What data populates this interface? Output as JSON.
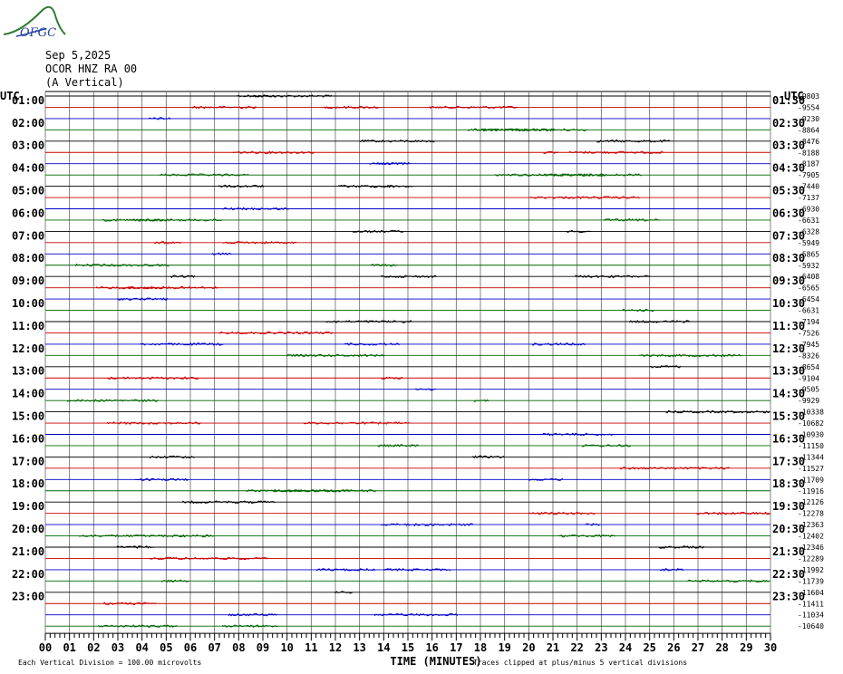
{
  "logo": {
    "text": "OFGC"
  },
  "header": {
    "date": "Sep 5,2025",
    "station": "OCOR HNZ RA 00",
    "component": "(A Vertical)"
  },
  "utc_label": "UTC",
  "chart_data": {
    "type": "helicorder",
    "x": {
      "label": "TIME (MINUTES)",
      "range": [
        0,
        30
      ],
      "tick_labels": [
        "00",
        "01",
        "02",
        "03",
        "04",
        "05",
        "06",
        "07",
        "08",
        "09",
        "10",
        "11",
        "12",
        "13",
        "14",
        "15",
        "16",
        "17",
        "18",
        "19",
        "20",
        "21",
        "22",
        "23",
        "24",
        "25",
        "26",
        "27",
        "28",
        "29",
        "30"
      ]
    },
    "left_labels": [
      "01:00",
      "02:00",
      "03:00",
      "04:00",
      "05:00",
      "06:00",
      "07:00",
      "08:00",
      "09:00",
      "10:00",
      "11:00",
      "12:00",
      "13:00",
      "14:00",
      "15:00",
      "16:00",
      "17:00",
      "18:00",
      "19:00",
      "20:00",
      "21:00",
      "22:00",
      "23:00"
    ],
    "right_labels": [
      "01:30",
      "02:30",
      "03:30",
      "04:30",
      "05:30",
      "06:30",
      "07:30",
      "08:30",
      "09:30",
      "10:30",
      "11:30",
      "12:30",
      "13:30",
      "14:30",
      "15:30",
      "16:30",
      "17:30",
      "18:30",
      "19:30",
      "20:30",
      "21:30",
      "22:30",
      "23:30"
    ],
    "trace_offsets": [
      "-9803",
      "-9554",
      "-9230",
      "-8864",
      "-8476",
      "-8188",
      "-8187",
      "-7905",
      "-7440",
      "-7137",
      "-6930",
      "-6631",
      "-6328",
      "-5949",
      "-5865",
      "-5932",
      "-6408",
      "-6565",
      "-6454",
      "-6631",
      "-7194",
      "-7526",
      "-7945",
      "-8326",
      "-8654",
      "-9104",
      "-9505",
      "-9929",
      "-10338",
      "-10682",
      "-10930",
      "-11150",
      "-11344",
      "-11527",
      "-11709",
      "-11916",
      "-12126",
      "-12278",
      "-12363",
      "-12402",
      "-12346",
      "-12289",
      "-11992",
      "-11739",
      "-11604",
      "-11411",
      "-11034",
      "-10640"
    ],
    "trace_colors": [
      "#000000",
      "#cc0000",
      "#0000cc",
      "#006600"
    ],
    "footer": {
      "scale": "Each Vertical Division =  100.00 microvolts",
      "clip": "Traces clipped at plus/minus 5 vertical divisions"
    }
  }
}
